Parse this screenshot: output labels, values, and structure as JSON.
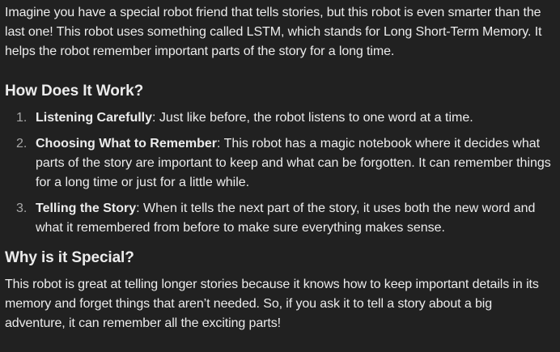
{
  "intro": "Imagine you have a special robot friend that tells stories, but this robot is even smarter than the last one! This robot uses something called LSTM, which stands for Long Short-Term Memory. It helps the robot remember important parts of the story for a long time.",
  "section_how": {
    "heading": "How Does It Work?",
    "items": [
      {
        "number": "1.",
        "title": "Listening Carefully",
        "text": ": Just like before, the robot listens to one word at a time."
      },
      {
        "number": "2.",
        "title": "Choosing What to Remember",
        "text": ": This robot has a magic notebook where it decides what parts of the story are important to keep and what can be forgotten. It can remember things for a long time or just for a little while."
      },
      {
        "number": "3.",
        "title": "Telling the Story",
        "text": ": When it tells the next part of the story, it uses both the new word and what it remembered from before to make sure everything makes sense."
      }
    ]
  },
  "section_why": {
    "heading": "Why is it Special?",
    "text": "This robot is great at telling longer stories because it knows how to keep important details in its memory and forget things that aren’t needed. So, if you ask it to tell a story about a big adventure, it can remember all the exciting parts!"
  }
}
